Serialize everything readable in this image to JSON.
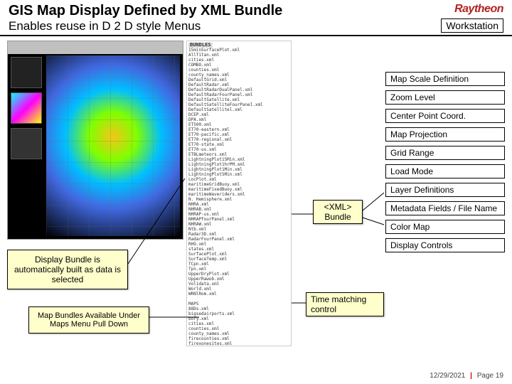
{
  "header": {
    "title": "GIS Map Display Defined by XML Bundle",
    "subtitle": "Enables reuse in D 2 D style Menus",
    "logo": "Raytheon",
    "workstation": "Workstation"
  },
  "rightBoxes": [
    "Map Scale Definition",
    "Zoom Level",
    "Center Point Coord.",
    "Map Projection",
    "Grid Range",
    "Load Mode",
    "Layer Definitions",
    "Metadata Fields / File Name",
    "Color Map",
    "Display Controls"
  ],
  "xmlBundle": {
    "line1": "<XML>",
    "line2": "Bundle"
  },
  "timeMatching": {
    "line1": "Time matching",
    "line2": "control"
  },
  "displayBundle": "Display Bundle is automatically built as data is selected",
  "mapBundles": "Map Bundles Available Under Maps Menu Pull Down",
  "xmlHeader": "BUNDLES",
  "xmlFiles": "15minSurfacePlot.xml\nAllTitan.xml\ncities.xml\nCOMBO.xml\ncounties.xml\ncounty_names.xml\nDefaultGrid.xml\nDefaultRadar.xml\nDefaultRadarDualPanel.xml\nDefaultRadarFourPanel.xml\nDefaultSatellite.xml\nDefaultSatelliteFourPanel.xml\nDefaultSatellitel.xml\nDCEP.xml\nDPA.xml\nET500.xml\nET70-eastern.xml\nET70-pacific.xml\nET70-regional.xml\nET70-state.xml\nET70-us.xml\nETBLmeteors.xml\nLightningPlot15Min.xml\nLightningPlot1hrPM.xml\nLightningPlot1Min.xml\nLightningPlot5Min.xml\nLocPlot.xml\nmaritimeGridBuoy.xml\nmaritimeFixedBuoy.xml\nmaritimeWaveriders.xml\nN. Hemisphere.xml\nNHRA.xml\nNHRAB.xml\nNHRAP-us.xml\nNHRAPfourPanel.xml\nNHRAW.xml\nNtb.xml\nRadar3D.xml\nRadarFourPanel.xml\nRHO.xml\nstates.xml\nSurfacePlot.xml\nSurfaceTemp.xml\nTCpn.xml\nTpn.xml\nUpperDryPlot.xml\nUpperRawob.xml\nVol1data.xml\nWorld.xml\nWRNlRom.xml\n\nMAPS\n88Ds.xml\nbigsedairports.xml\nbory.xml\ncities.xml\ncounties.xml\ncounty_names.xml\nfirecounties.xml\nfirexonesites.xml\nInterstates.xml\nlakes.xml\nlatlonlines.xml\nmetro.xml\nrail.xml\nstates.xml\nusa.xml\nworld.xml",
  "footer": {
    "date": "12/29/2021",
    "page": "Page 19"
  }
}
